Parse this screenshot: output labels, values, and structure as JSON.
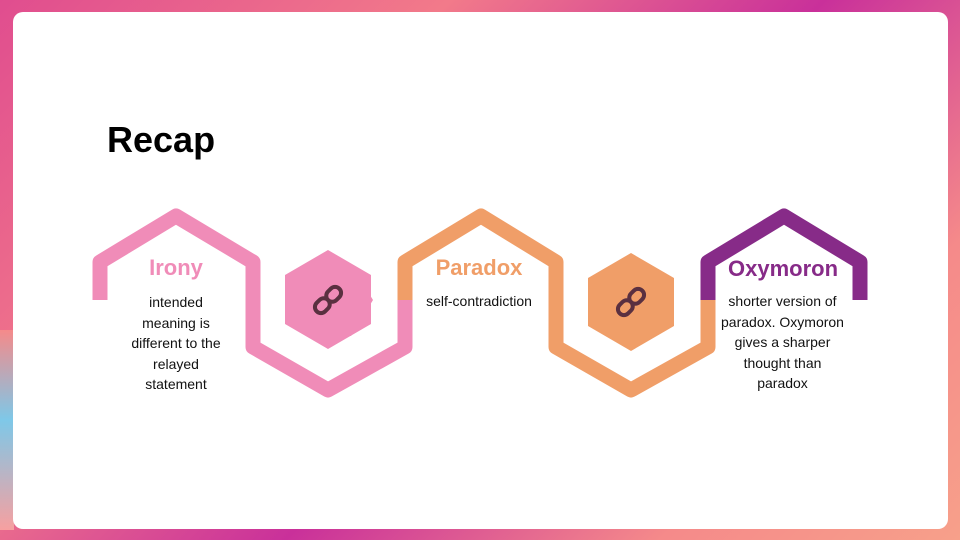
{
  "slide": {
    "title": "Recap"
  },
  "steps": [
    {
      "title": "Irony",
      "body": "intended meaning is different to the relayed statement",
      "color": "#f08cb8"
    },
    {
      "title": "Paradox",
      "body": "self-contradiction",
      "color": "#f09e68"
    },
    {
      "title": "Oxymoron",
      "body": "shorter version of paradox. Oxymoron gives a sharper thought than paradox",
      "color": "#872b88"
    }
  ],
  "connectors": [
    {
      "icon": "link-icon",
      "color": "#f08cb8"
    },
    {
      "icon": "link-icon",
      "color": "#f09e68"
    }
  ],
  "colors": {
    "irony": "#f08cb8",
    "paradox": "#f09e68",
    "oxymoron": "#872b88",
    "link_icon": "#5a3040"
  }
}
